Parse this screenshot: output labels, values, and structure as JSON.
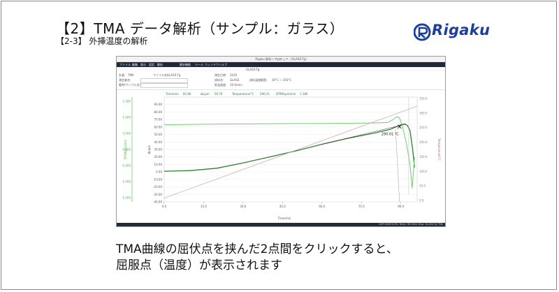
{
  "slide": {
    "title": "【2】TMA データ解析（サンプル：ガラス）",
    "subtitle": "【2-3】 外挿温度の解析",
    "logo_text": "Rigaku",
    "caption_line1": "TMA曲線の屈伏点を挟んだ2点間をクリックすると、",
    "caption_line2": "屈服点（温度）が表示されます",
    "colors": {
      "brand": "#1b3f9a",
      "menubar": "#1e2a3a",
      "tma_curve": "#2e7d32",
      "dtma_curve": "#6fcf6f",
      "temp_line": "#c8a0a0"
    }
  },
  "app": {
    "window_title": "Rigaku 解析ソフトウェア - [GLASS-Tg]",
    "menu": [
      "ファイル",
      "編集",
      "表示",
      "設定",
      "解析",
      "解析機能",
      "ツール",
      "ウィンドウ",
      "ヘルプ"
    ],
    "tab": "GLASS-Tg",
    "info": [
      {
        "label": "計量:",
        "value": "TMA"
      },
      {
        "label": "測定者名:",
        "value": ""
      },
      {
        "label": "備考(サンプル名):",
        "value": ""
      },
      {
        "label": "ファイル名:",
        "value": "GLASS-Tg"
      },
      {
        "label": "測定日時:",
        "value": "2016"
      },
      {
        "label": "試料名:",
        "value": "GLASS"
      },
      {
        "label": "昇温速度:",
        "value": "10 K/min"
      },
      {
        "label": "試料温度範囲:",
        "value": "30°C ~ 350°C"
      }
    ],
    "status_text": "CAPS  NUM  SCRL  Temp: 96.0min  Disp: GLASS-Tg  TMA"
  },
  "chart_data": {
    "type": "line",
    "readout": {
      "time_label": "Time/min",
      "time": "82.86",
      "dl_label": "ΔL/μm",
      "dl": "56.70",
      "temp_label": "Temperature/°C",
      "temp": "290.21",
      "dtma_label": "DTMA/μm/min",
      "dtma": "1.180"
    },
    "xlabel": "Time/min",
    "x_ticks": [
      "0.0",
      "15.0",
      "30.0",
      "45.0",
      "60.0",
      "75.0",
      "90.0"
    ],
    "xlim": [
      0,
      96.2
    ],
    "yleft_ticks": [
      "90.00",
      "80.00",
      "70.00",
      "60.00",
      "50.00",
      "40.00",
      "30.00",
      "20.00",
      "10.00",
      "0.00",
      "-10.00",
      "-20.00",
      "-30.00",
      "-40.00"
    ],
    "ylim": [
      -40,
      100
    ],
    "ylabel": "ΔL/μm",
    "yleft2_ticks": [
      "1.500",
      "1.000",
      "0.500",
      "0.000",
      "-0.500",
      "-1.000",
      "-1.500"
    ],
    "ylabel2": "DTMA/μm/min",
    "yright_ticks": [
      "350.0",
      "300.0",
      "250.0",
      "200.0",
      "150.0",
      "100.0",
      "50.0",
      "0.0"
    ],
    "yright_label": "Temperature/°C",
    "annotation": "290.01 °C",
    "series": [
      {
        "name": "TMA",
        "values": [
          [
            0,
            1
          ],
          [
            10,
            1.8
          ],
          [
            20,
            5
          ],
          [
            30,
            12
          ],
          [
            40,
            20
          ],
          [
            50,
            28
          ],
          [
            60,
            37
          ],
          [
            70,
            45
          ],
          [
            80,
            52
          ],
          [
            86,
            57
          ],
          [
            88,
            60
          ],
          [
            90,
            63
          ],
          [
            91.5,
            64
          ],
          [
            92.5,
            62
          ],
          [
            93.5,
            55
          ],
          [
            94.5,
            30
          ],
          [
            95.2,
            6
          ]
        ]
      },
      {
        "name": "DTMA",
        "values": [
          [
            0,
            63
          ],
          [
            10,
            63.5
          ],
          [
            20,
            64
          ],
          [
            30,
            64.2
          ],
          [
            40,
            64.4
          ],
          [
            50,
            64.6
          ],
          [
            60,
            64.8
          ],
          [
            70,
            65
          ],
          [
            80,
            65.5
          ],
          [
            85,
            66
          ],
          [
            87,
            70
          ],
          [
            88.5,
            74
          ],
          [
            89.5,
            72
          ],
          [
            90.5,
            62
          ],
          [
            92,
            40
          ],
          [
            93.5,
            10
          ],
          [
            94.3,
            -22
          ],
          [
            95.2,
            20
          ]
        ]
      },
      {
        "name": "Temperature",
        "values": [
          [
            0,
            -35
          ],
          [
            96.2,
            88
          ]
        ]
      }
    ]
  }
}
